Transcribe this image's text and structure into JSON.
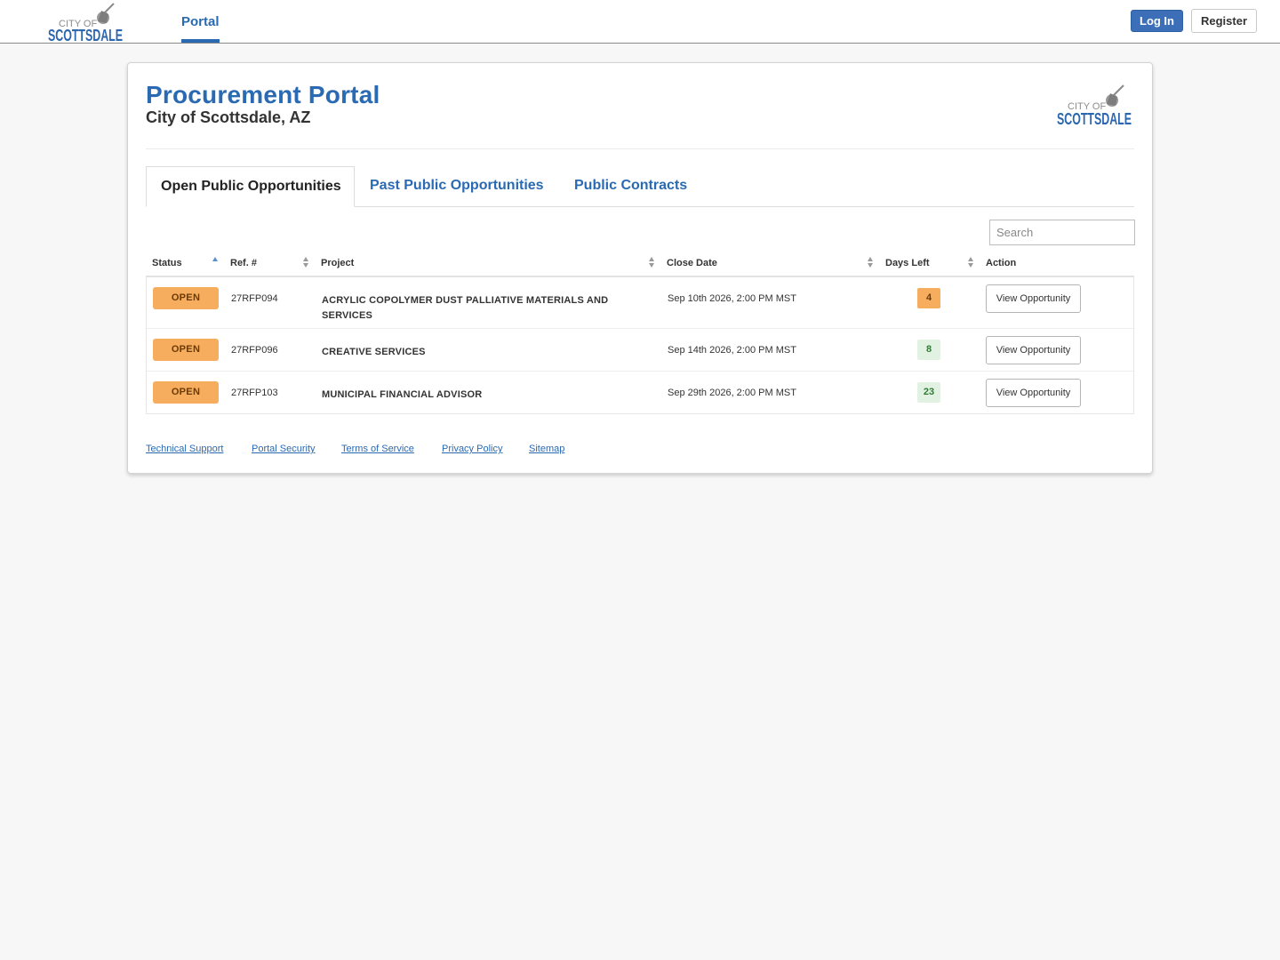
{
  "header": {
    "logo_line1": "CITY OF",
    "logo_line2": "SCOTTSDALE",
    "nav_portal": "Portal",
    "login_label": "Log In",
    "register_label": "Register"
  },
  "card": {
    "title": "Procurement Portal",
    "subtitle": "City of Scottsdale, AZ",
    "logo_line1": "CITY OF",
    "logo_line2": "SCOTTSDALE"
  },
  "tabs": [
    {
      "label": "Open Public Opportunities",
      "active": true
    },
    {
      "label": "Past Public Opportunities",
      "active": false
    },
    {
      "label": "Public Contracts",
      "active": false
    }
  ],
  "search": {
    "placeholder": "Search",
    "value": ""
  },
  "table": {
    "columns": [
      "Status",
      "Ref. #",
      "Project",
      "Close Date",
      "Days Left",
      "Action"
    ],
    "rows": [
      {
        "status": "OPEN",
        "ref": "27RFP094",
        "project": "ACRYLIC COPOLYMER DUST PALLIATIVE MATERIALS AND SERVICES",
        "close_date": "Sep 10th 2026, 2:00 PM MST",
        "days_left": "4",
        "action": "View Opportunity"
      },
      {
        "status": "OPEN",
        "ref": "27RFP096",
        "project": "CREATIVE SERVICES",
        "close_date": "Sep 14th 2026, 2:00 PM MST",
        "days_left": "8",
        "action": "View Opportunity"
      },
      {
        "status": "OPEN",
        "ref": "27RFP103",
        "project": "MUNICIPAL FINANCIAL ADVISOR",
        "close_date": "Sep 29th 2026, 2:00 PM MST",
        "days_left": "23",
        "action": "View Opportunity"
      }
    ]
  },
  "footer": {
    "links": [
      "Technical Support",
      "Portal Security",
      "Terms of Service",
      "Privacy Policy",
      "Sitemap"
    ]
  },
  "colors": {
    "brand_blue": "#2a6ab2",
    "login_blue": "#3d6fb8",
    "status_orange": "#f6ad5d",
    "days_ok_green": "#2e7d32"
  }
}
